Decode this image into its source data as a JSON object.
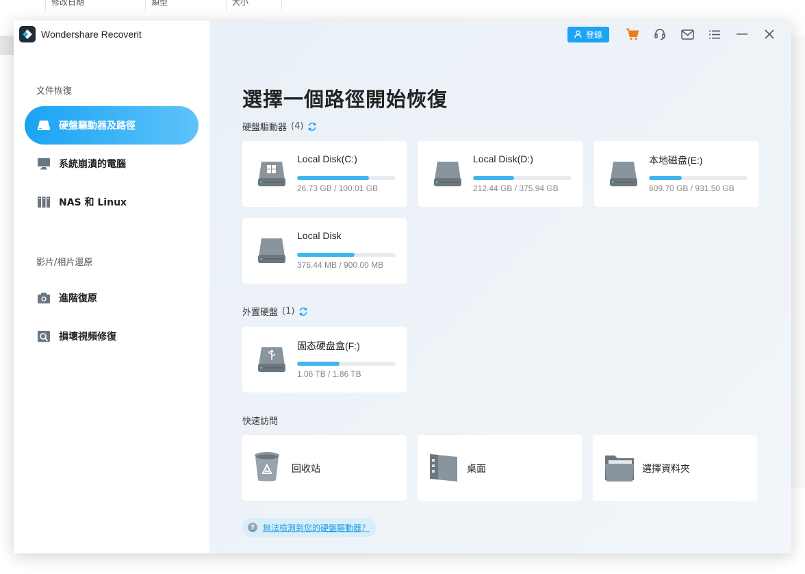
{
  "background_explorer": {
    "columns": [
      "修改日期",
      "類型",
      "大小"
    ]
  },
  "app": {
    "title": "Wondershare Recoverit"
  },
  "sidebar": {
    "section_file_recovery": "文件恢復",
    "section_media": "影片/相片還原",
    "items": [
      {
        "label": "硬盤驅動器及路徑",
        "icon": "hard-drive-icon",
        "active": true
      },
      {
        "label": "系統崩潰的電腦",
        "icon": "monitor-icon",
        "active": false
      },
      {
        "label": "NAS 和 Linux",
        "icon": "nas-icon",
        "active": false
      },
      {
        "label": "進階復原",
        "icon": "camera-icon",
        "active": false
      },
      {
        "label": "損壞視頻修復",
        "icon": "video-repair-icon",
        "active": false
      }
    ]
  },
  "toolbar": {
    "login_label": "登錄",
    "icons": [
      "cart-icon",
      "headset-icon",
      "mail-icon",
      "menu-icon",
      "minimize-icon",
      "close-icon"
    ]
  },
  "main": {
    "title": "選擇一個路徑開始恢復",
    "drives_label": "硬盤驅動器",
    "drives_count": "(4)",
    "external_label": "外置硬盤",
    "external_count": "(1)",
    "quick_label": "快速訪問",
    "help_text": "無法檢測到您的硬盤驅動器？",
    "help_icon_text": "?"
  },
  "drives": [
    {
      "name": "Local Disk(C:)",
      "size": "26.73 GB / 100.01 GB",
      "fill": 0.73,
      "windows": true
    },
    {
      "name": "Local Disk(D:)",
      "size": "212.44 GB / 375.94 GB",
      "fill": 0.42,
      "windows": false
    },
    {
      "name": "本地磁盘(E:)",
      "size": "609.70 GB / 931.50 GB",
      "fill": 0.33,
      "windows": false
    },
    {
      "name": "Local Disk",
      "size": "376.44 MB / 900.00 MB",
      "fill": 0.58,
      "windows": false
    }
  ],
  "external": [
    {
      "name": "固态硬盘盒(F:)",
      "size": "1.06 TB / 1.86 TB",
      "fill": 0.43,
      "usb": true
    }
  ],
  "quick_access": [
    {
      "label": "回收站",
      "icon": "recycle-bin-icon"
    },
    {
      "label": "桌面",
      "icon": "desktop-icon"
    },
    {
      "label": "選擇資料夾",
      "icon": "folder-icon"
    }
  ],
  "colors": {
    "accent": "#1ba3f4",
    "progress": "#3fb6f0",
    "cart": "#f07d1a"
  }
}
